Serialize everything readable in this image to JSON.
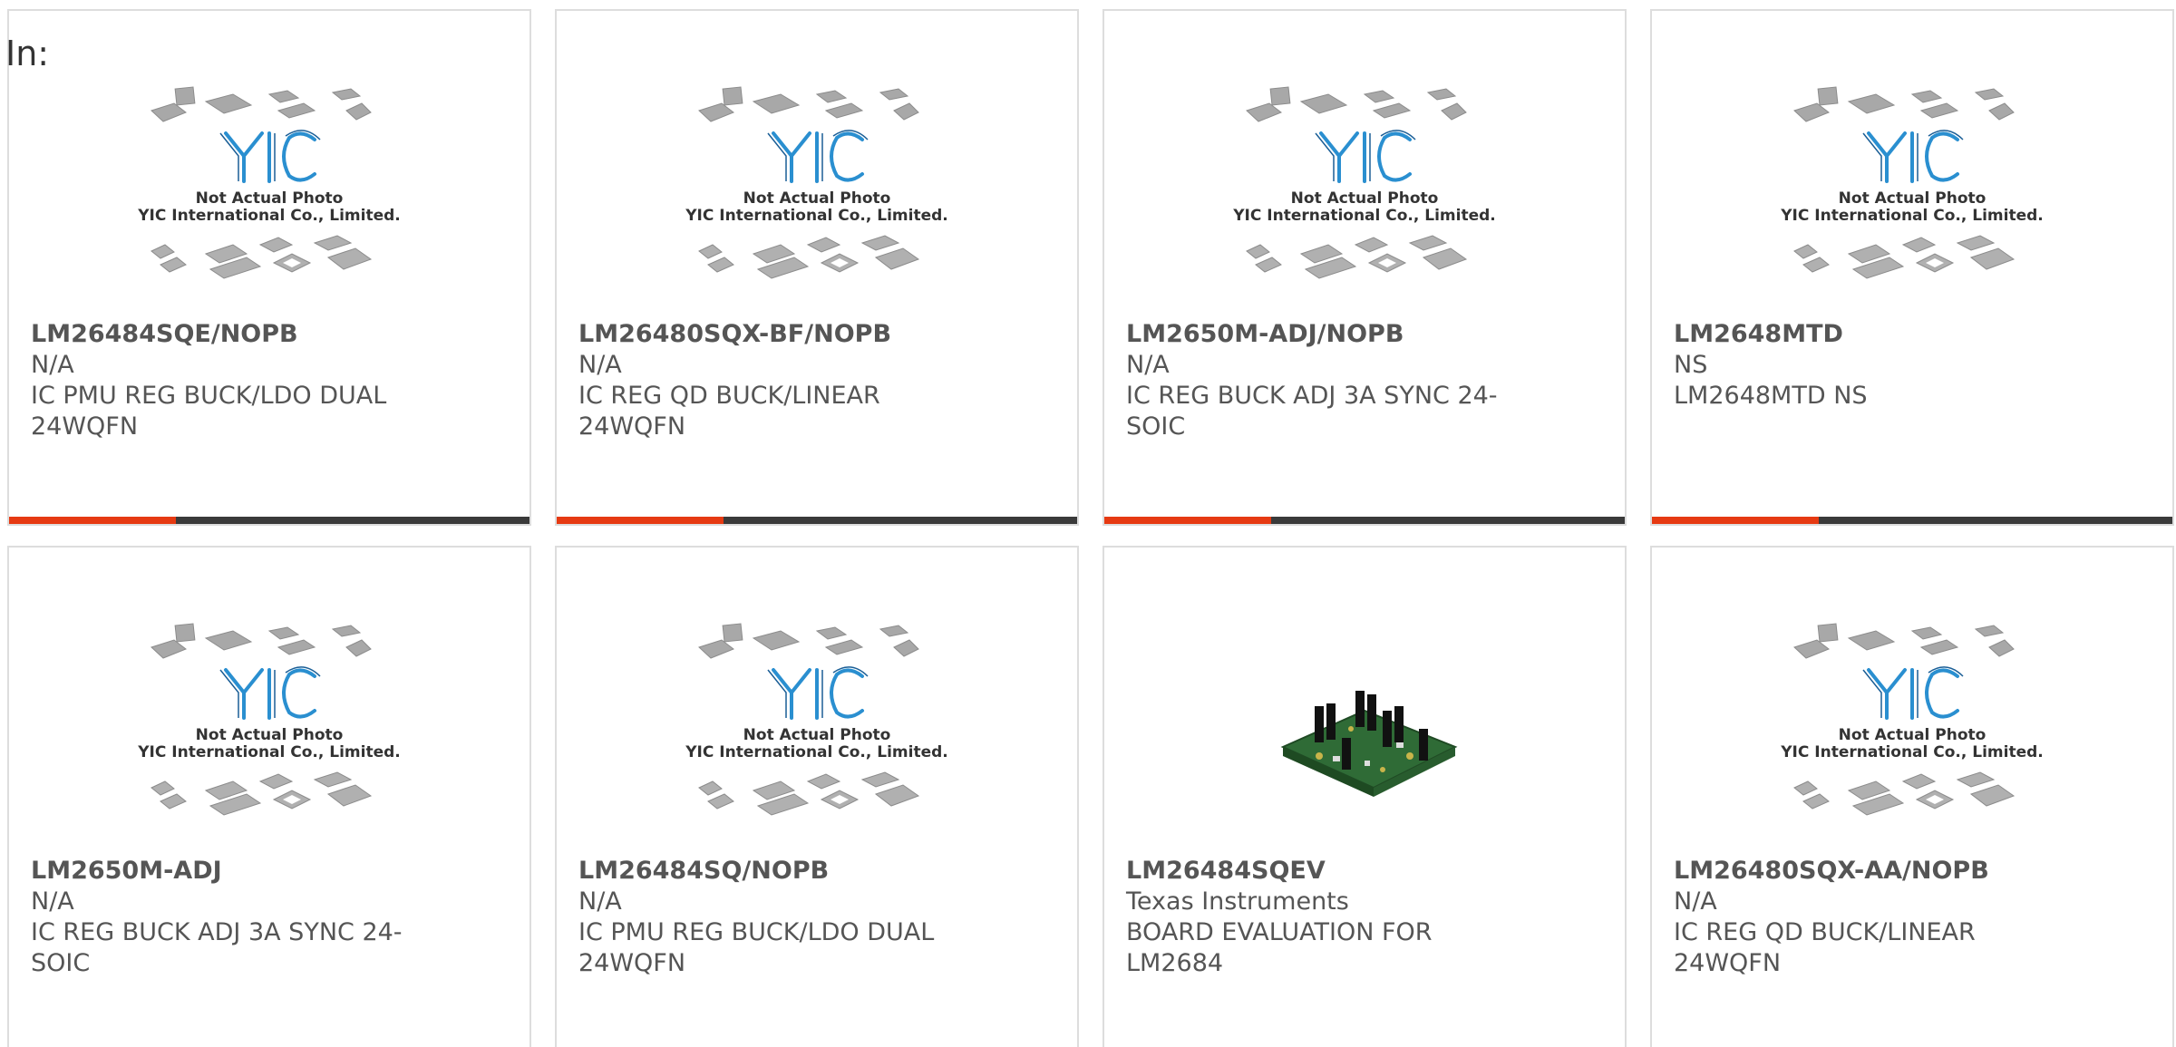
{
  "filter_label": "In:",
  "colors": {
    "accent": "#e63a12",
    "bar": "#3a3a3a",
    "logo": "#2a8fd0"
  },
  "placeholder": {
    "logo_text": "YIC",
    "line1": "Not Actual Photo",
    "line2": "YIC International Co., Limited."
  },
  "products": [
    {
      "part": "LM26484SQE/NOPB",
      "manufacturer": "N/A",
      "description": "IC PMU REG BUCK/LDO DUAL 24WQFN",
      "image": "placeholder",
      "bar": true
    },
    {
      "part": "LM26480SQX-BF/NOPB",
      "manufacturer": "N/A",
      "description": "IC REG QD BUCK/LINEAR 24WQFN",
      "image": "placeholder",
      "bar": true
    },
    {
      "part": "LM2650M-ADJ/NOPB",
      "manufacturer": "N/A",
      "description": "IC REG BUCK ADJ 3A SYNC 24-SOIC",
      "image": "placeholder",
      "bar": true
    },
    {
      "part": "LM2648MTD",
      "manufacturer": "NS",
      "description": "LM2648MTD NS",
      "image": "placeholder",
      "bar": true
    },
    {
      "part": "LM2650M-ADJ",
      "manufacturer": "N/A",
      "description": "IC REG BUCK ADJ 3A SYNC 24-SOIC",
      "image": "placeholder",
      "bar": false
    },
    {
      "part": "LM26484SQ/NOPB",
      "manufacturer": "N/A",
      "description": "IC PMU REG BUCK/LDO DUAL 24WQFN",
      "image": "placeholder",
      "bar": false
    },
    {
      "part": "LM26484SQEV",
      "manufacturer": "Texas Instruments",
      "description": "BOARD EVALUATION FOR LM2684",
      "image": "board",
      "bar": false
    },
    {
      "part": "LM26480SQX-AA/NOPB",
      "manufacturer": "N/A",
      "description": "IC REG QD BUCK/LINEAR 24WQFN",
      "image": "placeholder",
      "bar": false
    }
  ]
}
